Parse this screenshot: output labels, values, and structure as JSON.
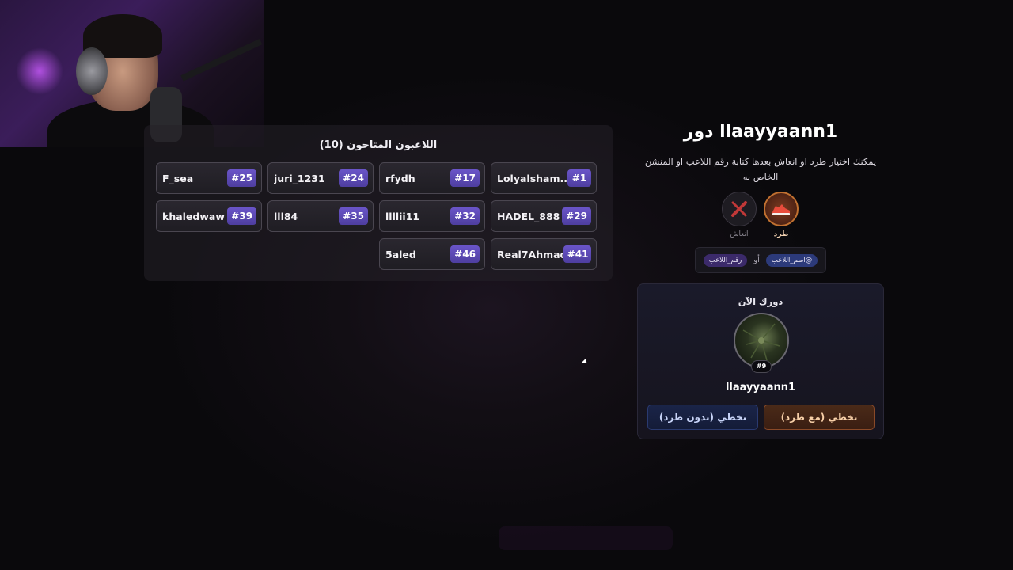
{
  "players_panel": {
    "title": "اللاعبون المتاحون (10)",
    "players": [
      {
        "name": "Lolyalsham...",
        "num": "#1"
      },
      {
        "name": "rfydh",
        "num": "#17"
      },
      {
        "name": "juri_1231",
        "num": "#24"
      },
      {
        "name": "F_sea",
        "num": "#25"
      },
      {
        "name": "HADEL_888",
        "num": "#29"
      },
      {
        "name": "llllii11",
        "num": "#32"
      },
      {
        "name": "lll84",
        "num": "#35"
      },
      {
        "name": "khaledwaw",
        "num": "#39"
      },
      {
        "name": "Real7Ahmad",
        "num": "#41"
      },
      {
        "name": "5aled",
        "num": "#46"
      }
    ]
  },
  "turn": {
    "title": "دور llaayyaann1",
    "description": "يمكنك اختيار طرد او انعاش بعدها كتابة رقم اللاعب او المنشن الخاص به"
  },
  "actions": {
    "kick": {
      "label": "طرد",
      "icon": "sneaker-icon"
    },
    "revive": {
      "label": "انعاش",
      "icon": "syringe-icon"
    }
  },
  "hint": {
    "mention_chip": "@اسم_اللاعب",
    "or": "أو",
    "number_chip": "رقم_اللاعب"
  },
  "current": {
    "label": "دورك الآن",
    "badge": "#9",
    "name": "llaayyaann1",
    "skip_with_kick": "تخطي (مع طرد)",
    "skip_without_kick": "تخطي (بدون طرد)"
  },
  "colors": {
    "accent_purple": "#5a48b8",
    "kick_orange": "#c07030",
    "skip_blue": "#2a3a70"
  }
}
